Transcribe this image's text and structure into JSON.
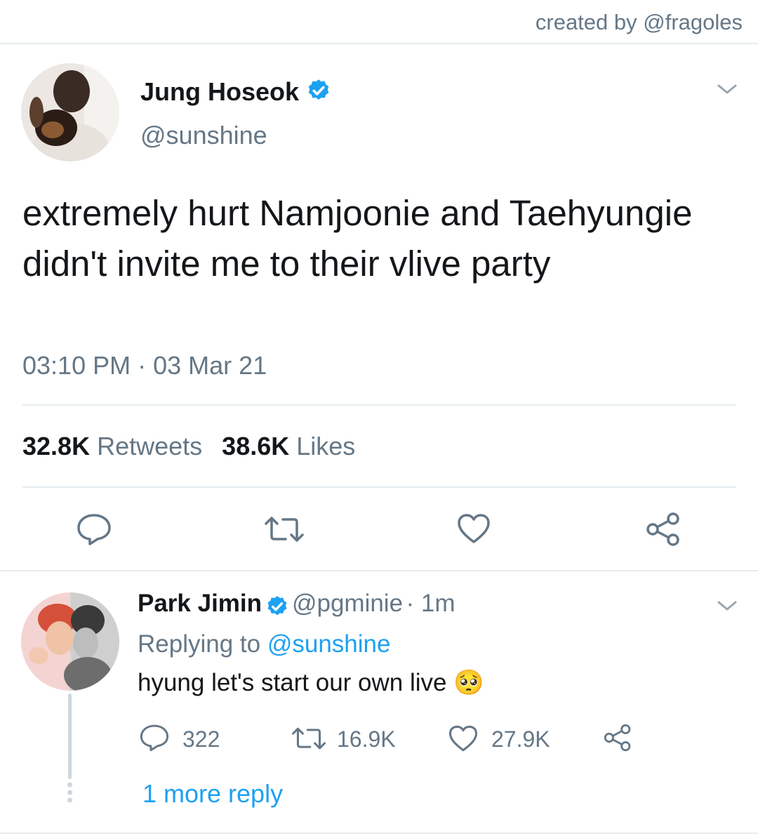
{
  "credit": "created by @fragoles",
  "tweet": {
    "author_name": "Jung Hoseok",
    "author_handle": "@sunshine",
    "text": "extremely hurt Namjoonie and Taehyungie didn't invite me to their vlive party",
    "time": "03:10 PM",
    "separator": "·",
    "date": "03 Mar 21",
    "retweets_count": "32.8K",
    "retweets_label": "Retweets",
    "likes_count": "38.6K",
    "likes_label": "Likes"
  },
  "reply": {
    "author_name": "Park Jimin",
    "author_handle": "@pgminie",
    "time": "· 1m",
    "replying_prefix": "Replying to",
    "replying_handle": "@sunshine",
    "text": "hyung let's start our own live",
    "emoji": "🥺",
    "reply_count": "322",
    "retweet_count": "16.9K",
    "like_count": "27.9K",
    "more_replies": "1 more reply"
  },
  "colors": {
    "accent": "#1da1f2",
    "secondary_text": "#657786",
    "divider": "#e6ecf0"
  }
}
